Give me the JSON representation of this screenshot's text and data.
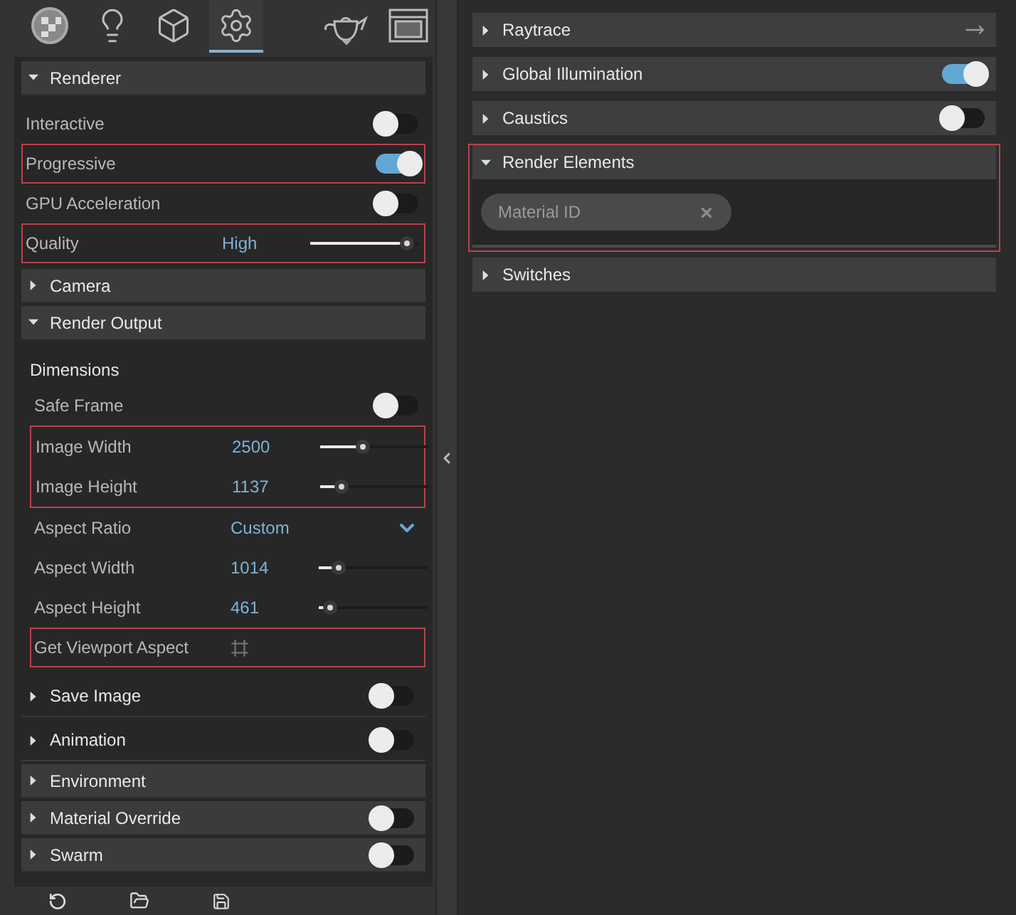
{
  "toolbar": {
    "tabs": [
      {
        "selected": false
      },
      {
        "selected": false
      },
      {
        "selected": false
      },
      {
        "selected": true
      },
      {
        "selected": false
      },
      {
        "selected": false
      }
    ]
  },
  "left_sections": [
    {
      "title": "Renderer",
      "kind": "bar",
      "expanded": true,
      "rows": [
        {
          "kind": "toggle",
          "label": "Interactive",
          "on": false,
          "highlighted": false
        },
        {
          "kind": "toggle",
          "label": "Progressive",
          "on": true,
          "highlighted": true
        },
        {
          "kind": "toggle",
          "label": "GPU Acceleration",
          "on": false,
          "highlighted": false
        },
        {
          "kind": "slider",
          "label": "Quality",
          "value": "High",
          "level": 0.9,
          "highlighted": true
        }
      ]
    },
    {
      "title": "Camera",
      "kind": "bar",
      "expanded": false
    },
    {
      "title": "Render Output",
      "kind": "bar",
      "expanded": true,
      "rows": [
        {
          "kind": "subheading",
          "label": "Dimensions"
        },
        {
          "kind": "toggle",
          "label": "Safe Frame",
          "on": false,
          "highlighted": false
        },
        {
          "kind": "group",
          "highlighted": true,
          "rows": [
            {
              "kind": "slider",
              "label": "Image Width",
              "value": "2500",
              "level": 0.4,
              "highlighted": false
            },
            {
              "kind": "slider",
              "label": "Image Height",
              "value": "1137",
              "level": 0.2,
              "highlighted": false
            }
          ]
        },
        {
          "kind": "dropdown",
          "label": "Aspect Ratio",
          "value": "Custom",
          "highlighted": false
        },
        {
          "kind": "slider",
          "label": "Aspect Width",
          "value": "1014",
          "level": 0.18,
          "highlighted": false
        },
        {
          "kind": "slider",
          "label": "Aspect Height",
          "value": "461",
          "level": 0.1,
          "highlighted": false
        },
        {
          "kind": "action",
          "label": "Get Viewport Aspect",
          "highlighted": true
        }
      ]
    },
    {
      "title": "Save Image",
      "kind": "plain",
      "expanded": false,
      "on": false
    },
    {
      "title": "Animation",
      "kind": "plain",
      "expanded": false,
      "on": false
    },
    {
      "title": "Environment",
      "kind": "bar",
      "expanded": false
    },
    {
      "title": "Material Override",
      "kind": "bar",
      "expanded": false,
      "on": false
    },
    {
      "title": "Swarm",
      "kind": "bar",
      "expanded": false,
      "on": false
    }
  ],
  "right_sections": [
    {
      "title": "Raytrace",
      "kind": "arrow",
      "expanded": false,
      "highlighted": false
    },
    {
      "title": "Global Illumination",
      "kind": "toggle",
      "expanded": false,
      "on": true,
      "highlighted": false
    },
    {
      "title": "Caustics",
      "kind": "toggle",
      "expanded": false,
      "on": false,
      "highlighted": false
    },
    {
      "title": "Render Elements",
      "kind": "elements",
      "expanded": true,
      "highlighted": true,
      "chips": [
        {
          "label": "Material ID"
        }
      ]
    },
    {
      "title": "Switches",
      "kind": "plain",
      "expanded": false,
      "highlighted": false
    }
  ]
}
